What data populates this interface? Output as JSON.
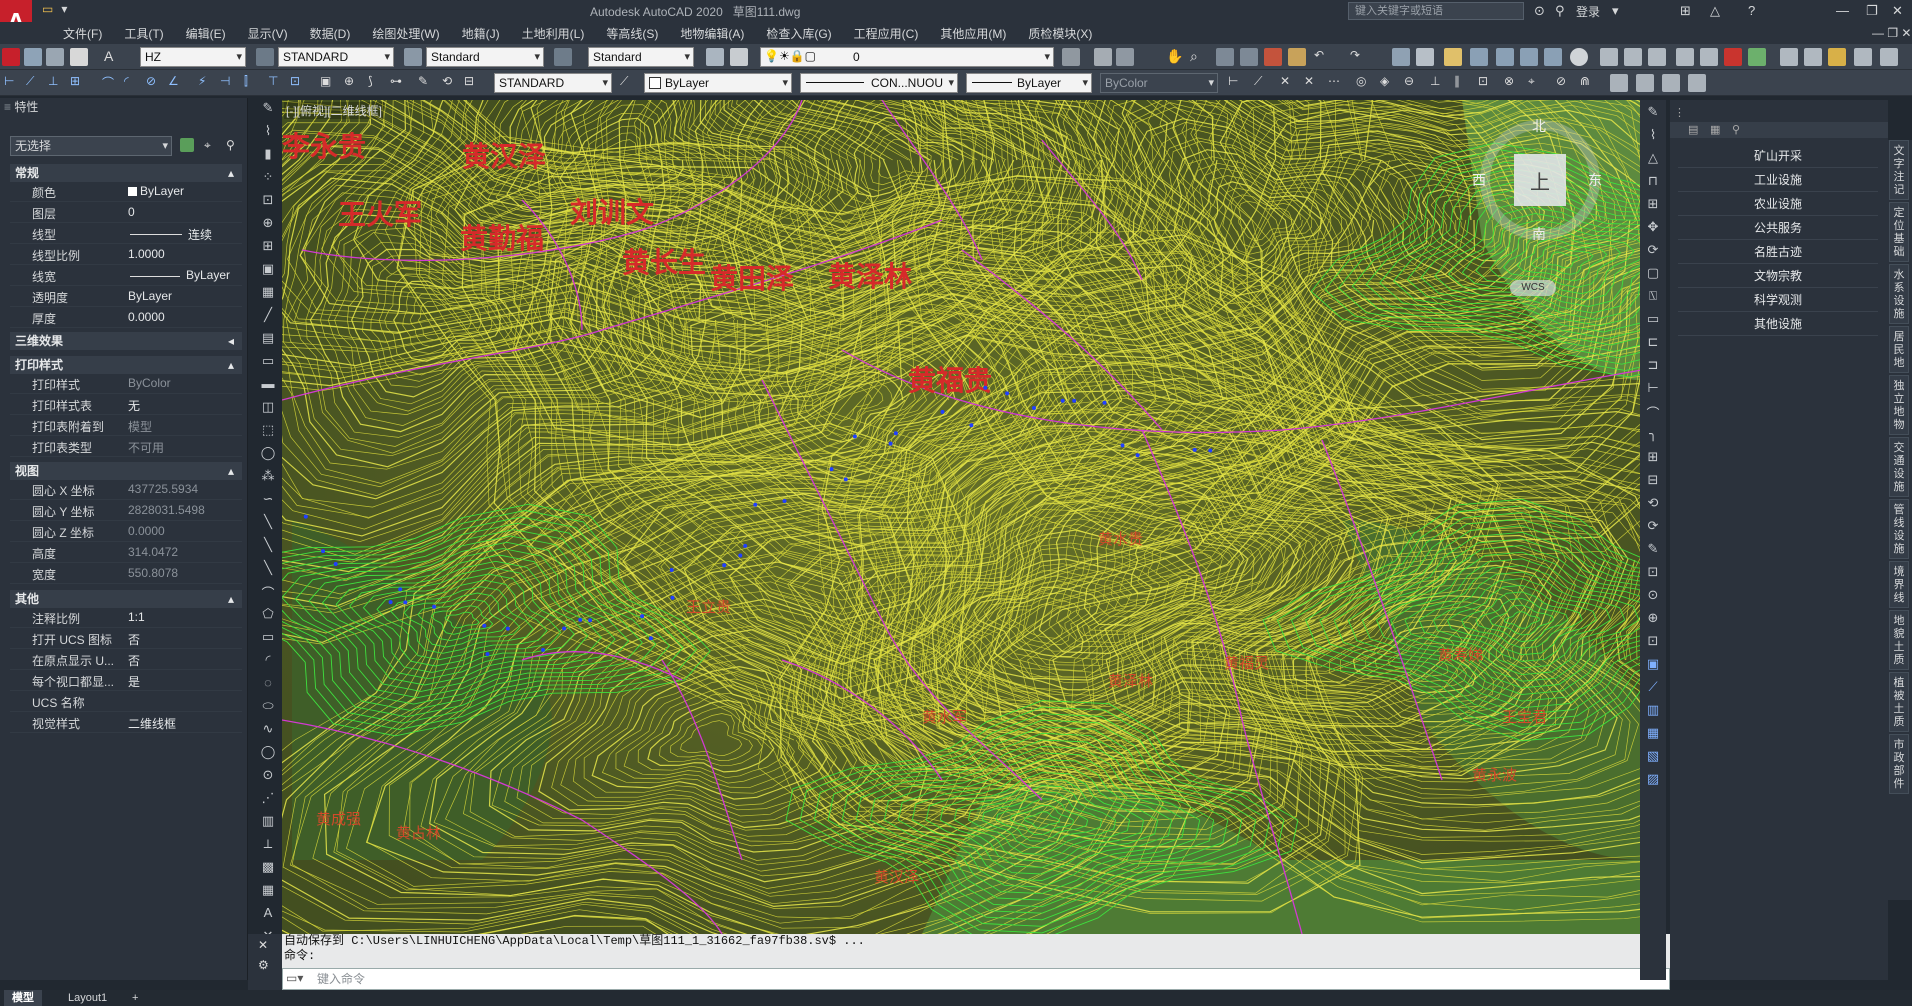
{
  "app": {
    "title": "Autodesk AutoCAD 2020",
    "document": "草图111.dwg",
    "logo_letter": "A",
    "search_placeholder": "键入关键字或短语",
    "login": "登录"
  },
  "menu": [
    "文件(F)",
    "工具(T)",
    "编辑(E)",
    "显示(V)",
    "数据(D)",
    "绘图处理(W)",
    "地籍(J)",
    "土地利用(L)",
    "等高线(S)",
    "地物编辑(A)",
    "检查入库(G)",
    "工程应用(C)",
    "其他应用(M)",
    "质检模块(X)"
  ],
  "toolbar1": {
    "text_style": "HZ",
    "dim_style": "STANDARD",
    "table_style": "Standard",
    "mleader_style": "Standard",
    "layer": "0"
  },
  "toolbar2": {
    "visual_style": "STANDARD",
    "color": "ByLayer",
    "linetype": "CON...NUOU",
    "lineweight": "ByLayer",
    "plotstyle": "ByColor"
  },
  "properties": {
    "title": "特性",
    "selection": "无选择",
    "sections": {
      "general": "常规",
      "three_d": "三维效果",
      "plot": "打印样式",
      "view": "视图",
      "misc": "其他"
    },
    "general": [
      {
        "label": "颜色",
        "value": "ByLayer"
      },
      {
        "label": "图层",
        "value": "0"
      },
      {
        "label": "线型",
        "value": "连续"
      },
      {
        "label": "线型比例",
        "value": "1.0000"
      },
      {
        "label": "线宽",
        "value": "ByLayer"
      },
      {
        "label": "透明度",
        "value": "ByLayer"
      },
      {
        "label": "厚度",
        "value": "0.0000"
      }
    ],
    "plot": [
      {
        "label": "打印样式",
        "value": "ByColor"
      },
      {
        "label": "打印样式表",
        "value": "无"
      },
      {
        "label": "打印表附着到",
        "value": "模型"
      },
      {
        "label": "打印表类型",
        "value": "不可用"
      }
    ],
    "view": [
      {
        "label": "圆心 X 坐标",
        "value": "437725.5934"
      },
      {
        "label": "圆心 Y 坐标",
        "value": "2828031.5498"
      },
      {
        "label": "圆心 Z 坐标",
        "value": "0.0000"
      },
      {
        "label": "高度",
        "value": "314.0472"
      },
      {
        "label": "宽度",
        "value": "550.8078"
      }
    ],
    "misc": [
      {
        "label": "注释比例",
        "value": "1:1"
      },
      {
        "label": "打开 UCS 图标",
        "value": "否"
      },
      {
        "label": "在原点显示 U...",
        "value": "否"
      },
      {
        "label": "每个视口都显...",
        "value": "是"
      },
      {
        "label": "UCS 名称",
        "value": ""
      },
      {
        "label": "视觉样式",
        "value": "二维线框"
      }
    ]
  },
  "viewport": {
    "label": "[-][俯视][二维线框]",
    "viewcube": {
      "north": "北",
      "south": "南",
      "east": "东",
      "west": "西",
      "top": "上",
      "wcs": "WCS"
    },
    "big_labels": [
      "李永贵",
      "黄汉泽",
      "王火军",
      "黄勤福",
      "刘训文",
      "黄长生",
      "黄田泽",
      "黄泽林",
      "黄福贵"
    ],
    "small_labels": [
      "黄水贵",
      "王立贵",
      "黄水军",
      "黄成强",
      "黄占林",
      "黄汉泽",
      "黄泽林",
      "黄福灵",
      "黄寿娣",
      "王宝君",
      "黄永波"
    ]
  },
  "command": {
    "history_line1": "自动保存到 C:\\Users\\LINHUICHENG\\AppData\\Local\\Temp\\草图111_1_31662_fa97fb38.sv$ ...",
    "history_line2": "命令:",
    "placeholder": "键入命令"
  },
  "right_panel": [
    "矿山开采",
    "工业设施",
    "农业设施",
    "公共服务",
    "名胜古迹",
    "文物宗教",
    "科学观测",
    "其他设施"
  ],
  "vertical_tabs": [
    "文字注记",
    "定位基础",
    "水系设施",
    "居民地",
    "独立地物",
    "交通设施",
    "管线设施",
    "境界线",
    "地貌土质",
    "植被土质",
    "市政部件"
  ],
  "status_tabs": [
    "模型",
    "Layout1",
    "+"
  ]
}
